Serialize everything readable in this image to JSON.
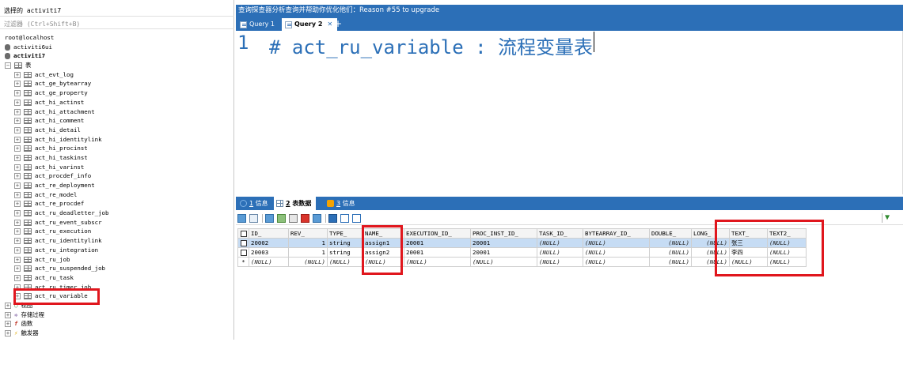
{
  "left_panel": {
    "selected_db_label": "选择的 activiti7",
    "filter_placeholder": "过滤器 (Ctrl+Shift+B)",
    "tree": {
      "host": "root@localhost",
      "databases": [
        "activiti6ui",
        "activiti7"
      ],
      "tables_folder": "表",
      "tables": [
        "act_evt_log",
        "act_ge_bytearray",
        "act_ge_property",
        "act_hi_actinst",
        "act_hi_attachment",
        "act_hi_comment",
        "act_hi_detail",
        "act_hi_identitylink",
        "act_hi_procinst",
        "act_hi_taskinst",
        "act_hi_varinst",
        "act_procdef_info",
        "act_re_deployment",
        "act_re_model",
        "act_re_procdef",
        "act_ru_deadletter_job",
        "act_ru_event_subscr",
        "act_ru_execution",
        "act_ru_identitylink",
        "act_ru_integration",
        "act_ru_job",
        "act_ru_suspended_job",
        "act_ru_task",
        "act_ru_timer_job",
        "act_ru_variable"
      ],
      "folders": [
        "视图",
        "存储过程",
        "函数",
        "触发器"
      ]
    }
  },
  "query_panel": {
    "title": "查询探查器分析查询并帮助你优化他们：Reason #55 to upgrade",
    "tabs": [
      {
        "label": "Query 1",
        "active": false
      },
      {
        "label": "Query 2",
        "active": true
      }
    ],
    "editor": {
      "line_number": "1",
      "code": "# act_ru_variable : 流程变量表"
    }
  },
  "results": {
    "tabs": [
      {
        "num": "1",
        "label": "信息",
        "active": false
      },
      {
        "num": "2",
        "label": "表数据",
        "active": true
      },
      {
        "num": "3",
        "label": "信息",
        "active": false
      }
    ],
    "columns": [
      "ID_",
      "REV_",
      "TYPE_",
      "NAME_",
      "EXECUTION_ID_",
      "PROC_INST_ID_",
      "TASK_ID_",
      "BYTEARRAY_ID_",
      "DOUBLE_",
      "LONG_",
      "TEXT_",
      "TEXT2_"
    ],
    "rows": [
      [
        "20002",
        "1",
        "string",
        "assign1",
        "20001",
        "20001",
        "(NULL)",
        "(NULL)",
        "(NULL)",
        "(NULL)",
        "张三",
        "(NULL)"
      ],
      [
        "20003",
        "1",
        "string",
        "assign2",
        "20001",
        "20001",
        "(NULL)",
        "(NULL)",
        "(NULL)",
        "(NULL)",
        "李四",
        "(NULL)"
      ],
      [
        "(NULL)",
        "(NULL)",
        "(NULL)",
        "(NULL)",
        "(NULL)",
        "(NULL)",
        "(NULL)",
        "(NULL)",
        "(NULL)",
        "(NULL)",
        "(NULL)",
        "(NULL)"
      ]
    ],
    "new_row_marker": "*"
  },
  "colors": {
    "accent": "#2c6fb7",
    "highlight_box": "#e0161d",
    "selected_row": "#c6dcf4"
  }
}
